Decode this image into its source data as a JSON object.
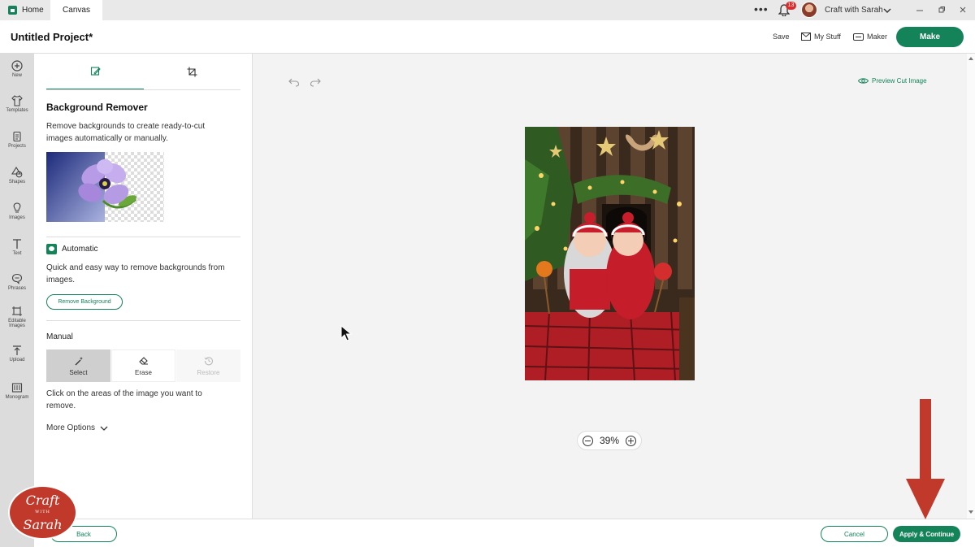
{
  "tabs": {
    "home": "Home",
    "canvas": "Canvas"
  },
  "topbar": {
    "notifications": "13",
    "account": "Craft with Sarah"
  },
  "header": {
    "title": "Untitled Project*",
    "save": "Save",
    "my_stuff": "My Stuff",
    "maker": "Maker",
    "make": "Make"
  },
  "rail": [
    {
      "label": "New",
      "icon": "plus-circle-icon"
    },
    {
      "label": "Templates",
      "icon": "shirt-icon"
    },
    {
      "label": "Projects",
      "icon": "projects-icon"
    },
    {
      "label": "Shapes",
      "icon": "shapes-icon"
    },
    {
      "label": "Images",
      "icon": "lightbulb-icon"
    },
    {
      "label": "Text",
      "icon": "text-icon"
    },
    {
      "label": "Phrases",
      "icon": "speech-icon"
    },
    {
      "label": "Editable Images",
      "icon": "editable-image-icon"
    },
    {
      "label": "Upload",
      "icon": "upload-icon"
    },
    {
      "label": "Monogram",
      "icon": "monogram-icon"
    }
  ],
  "panel": {
    "title": "Background Remover",
    "description": "Remove backgrounds to create ready-to-cut images automatically or manually.",
    "automatic_label": "Automatic",
    "automatic_desc": "Quick and easy way to remove backgrounds from images.",
    "remove_bg_button": "Remove Background",
    "manual_label": "Manual",
    "tools": {
      "select": "Select",
      "erase": "Erase",
      "restore": "Restore"
    },
    "hint": "Click on the areas of the image you want to remove.",
    "more_options": "More Options"
  },
  "canvas": {
    "preview_cut": "Preview Cut Image",
    "zoom": "39%"
  },
  "footer": {
    "back": "Back",
    "cancel": "Cancel",
    "apply": "Apply & Continue"
  },
  "watermark": {
    "line1": "Craft",
    "line2": "WITH",
    "line3": "Sarah"
  },
  "colors": {
    "accent": "#15835a",
    "arrow": "#c0392b"
  }
}
